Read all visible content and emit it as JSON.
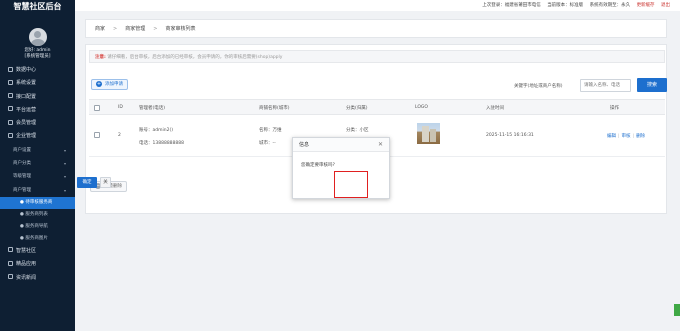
{
  "sidebar": {
    "brand": "智慧社区后台",
    "user": {
      "greeting": "您好: admin",
      "role": "[系统管理员]"
    },
    "items": [
      {
        "label": "数据中心",
        "kind": "top"
      },
      {
        "label": "系统设置",
        "kind": "top"
      },
      {
        "label": "接口配置",
        "kind": "top"
      },
      {
        "label": "平台运营",
        "kind": "top"
      },
      {
        "label": "会员管理",
        "kind": "top"
      },
      {
        "label": "企业管理",
        "kind": "top"
      },
      {
        "label": "商户设置",
        "kind": "sub",
        "caret": "▾"
      },
      {
        "label": "商户分类",
        "kind": "sub",
        "caret": "▾"
      },
      {
        "label": "等级管理",
        "kind": "sub",
        "caret": "▾"
      },
      {
        "label": "商户管理",
        "kind": "sub",
        "caret": "▾"
      },
      {
        "label": "● 待审核服务商",
        "kind": "leaf",
        "active": true
      },
      {
        "label": "● 服务商列表",
        "kind": "leaf"
      },
      {
        "label": "● 服务商导航",
        "kind": "leaf"
      },
      {
        "label": "● 服务商图片",
        "kind": "leaf"
      },
      {
        "label": "智慧社区",
        "kind": "top"
      },
      {
        "label": "精品应用",
        "kind": "top"
      },
      {
        "label": "资讯新闻",
        "kind": "top"
      }
    ]
  },
  "topbar": {
    "last_login": "上次登录：福建省莆田市电信",
    "version": "当前版本：标准版",
    "expiry": "系统有效期至：永久",
    "refresh": "更新缓存",
    "logout": "退出"
  },
  "breadcrumb": {
    "items": [
      "商家",
      "商家管理",
      "商家审核列表"
    ],
    "sep": ">"
  },
  "notice": {
    "prefix": "注意:",
    "text": "请仔细看，后台审核，后台添加的已经审核，会员申请的，你的审核后需要(shop)apply"
  },
  "toolbar": {
    "add_label": "添加申请",
    "search_label": "关键字(地址或商户名称)",
    "search_placeholder": "请输入名称、电话",
    "search_button": "搜索"
  },
  "table": {
    "headers": [
      "ID",
      "管理者(电话)",
      "商铺名称(城市)",
      "分类(归属)",
      "LOGO",
      "入驻时间",
      "操作"
    ],
    "rows": [
      {
        "id": "2",
        "manager_name": "账号：admin2()",
        "manager_phone": "电话：13888888888",
        "shop_name": "名称：万维",
        "shop_city": "城市：--",
        "category": "分类：小区",
        "belong": "归属：",
        "time": "2025-11-15 16:16:31",
        "ops": [
          "编辑",
          "审核",
          "删除"
        ]
      }
    ],
    "batch_delete": "批量删除"
  },
  "dialog": {
    "title": "信息",
    "message": "您确定要审核吗?",
    "confirm": "确定",
    "cancel": "关"
  }
}
